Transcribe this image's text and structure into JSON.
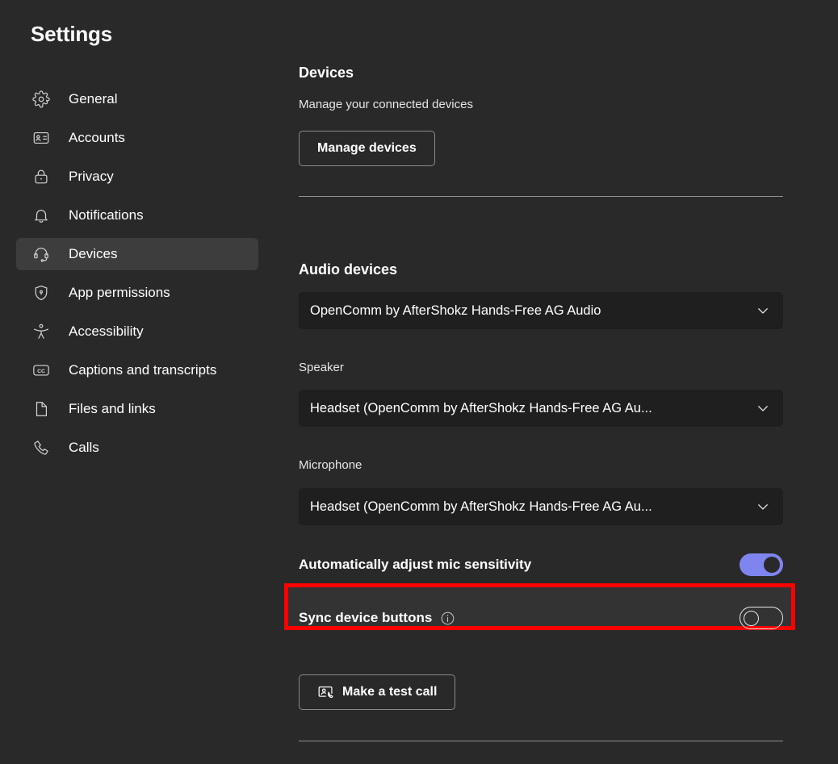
{
  "window": {
    "title": "Settings",
    "background": "#292929",
    "accent": "#7f85ef",
    "highlight_color": "#ff0000"
  },
  "sidebar": {
    "title": "Settings",
    "items": [
      {
        "label": "General",
        "icon": "gear-icon",
        "selected": false
      },
      {
        "label": "Accounts",
        "icon": "id-card-icon",
        "selected": false
      },
      {
        "label": "Privacy",
        "icon": "lock-icon",
        "selected": false
      },
      {
        "label": "Notifications",
        "icon": "bell-icon",
        "selected": false
      },
      {
        "label": "Devices",
        "icon": "headset-icon",
        "selected": true
      },
      {
        "label": "App permissions",
        "icon": "shield-lock-icon",
        "selected": false
      },
      {
        "label": "Accessibility",
        "icon": "person-accessibility-icon",
        "selected": false
      },
      {
        "label": "Captions and transcripts",
        "icon": "closed-caption-icon",
        "selected": false
      },
      {
        "label": "Files and links",
        "icon": "document-icon",
        "selected": false
      },
      {
        "label": "Calls",
        "icon": "phone-icon",
        "selected": false
      }
    ]
  },
  "main": {
    "devices_section": {
      "heading": "Devices",
      "subtext": "Manage your connected devices",
      "manage_button": "Manage devices"
    },
    "audio_section": {
      "heading": "Audio devices",
      "audio_device": {
        "value": "OpenComm by AfterShokz Hands-Free AG Audio",
        "chevron": "chevron-down-icon"
      },
      "speaker": {
        "label": "Speaker",
        "value": "Headset (OpenComm by AfterShokz Hands-Free AG Au...",
        "chevron": "chevron-down-icon"
      },
      "microphone": {
        "label": "Microphone",
        "value": "Headset (OpenComm by AfterShokz Hands-Free AG Au...",
        "chevron": "chevron-down-icon"
      },
      "auto_mic": {
        "label": "Automatically adjust mic sensitivity",
        "state": "on"
      },
      "sync_buttons": {
        "label": "Sync device buttons",
        "info_icon": "info-icon",
        "state": "off",
        "highlighted": true
      },
      "test_call_button": {
        "label": "Make a test call",
        "icon": "contact-card-phone-icon"
      }
    }
  }
}
